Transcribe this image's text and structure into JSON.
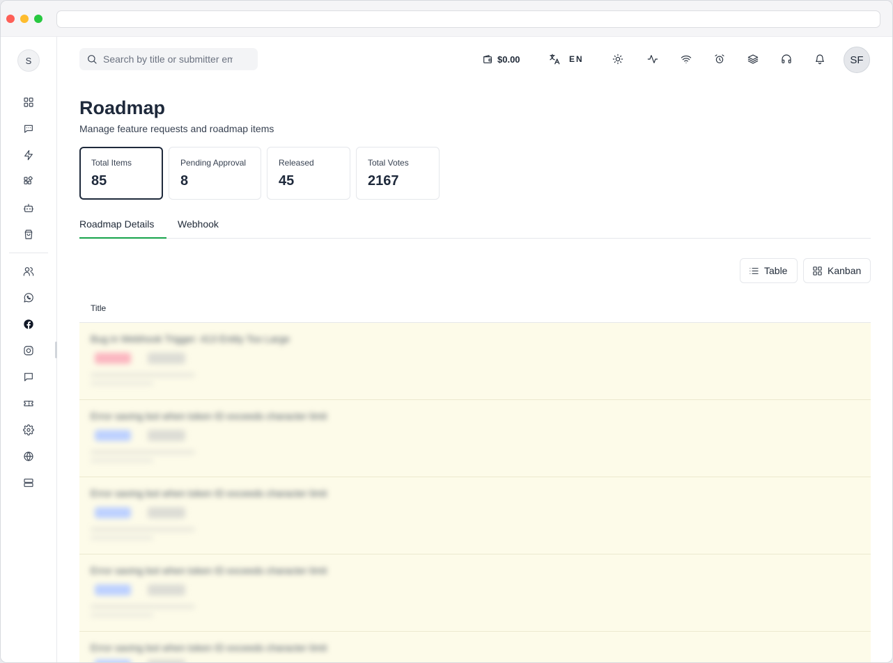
{
  "header": {
    "search_placeholder": "Search by title or submitter email",
    "wallet_amount": "$0.00",
    "language": "EN",
    "user_initials": "SF"
  },
  "sidebar": {
    "avatar_initial": "S",
    "icons": [
      "dashboard-icon",
      "chat-icon",
      "zap-icon",
      "apps-icon",
      "bot-icon",
      "shopping-bag-icon",
      "users-icon",
      "whatsapp-icon",
      "facebook-icon",
      "instagram-icon",
      "message-icon",
      "ticket-icon",
      "settings-icon",
      "globe-icon",
      "server-icon"
    ]
  },
  "page": {
    "title": "Roadmap",
    "subtitle": "Manage feature requests and roadmap items"
  },
  "stats": [
    {
      "label": "Total Items",
      "value": "85"
    },
    {
      "label": "Pending Approval",
      "value": "8"
    },
    {
      "label": "Released",
      "value": "45"
    },
    {
      "label": "Total Votes",
      "value": "2167"
    }
  ],
  "tabs": [
    {
      "label": "Roadmap Details"
    },
    {
      "label": "Webhook"
    }
  ],
  "views": {
    "table_label": "Table",
    "kanban_label": "Kanban"
  },
  "table": {
    "column_title": "Title",
    "rows": [
      {
        "title": "Bug in Webhook Trigger: 413 Entity Too Large",
        "badge_color": "#fbb6c0"
      },
      {
        "title": "Error saving bot when token ID exceeds character limit",
        "badge_color": "#bcd0ff"
      },
      {
        "title": "Error saving bot when token ID exceeds character limit",
        "badge_color": "#bcd0ff"
      },
      {
        "title": "Error saving bot when token ID exceeds character limit",
        "badge_color": "#bcd0ff"
      },
      {
        "title": "Error saving bot when token ID exceeds character limit",
        "badge_color": "#bcd0ff"
      }
    ]
  }
}
